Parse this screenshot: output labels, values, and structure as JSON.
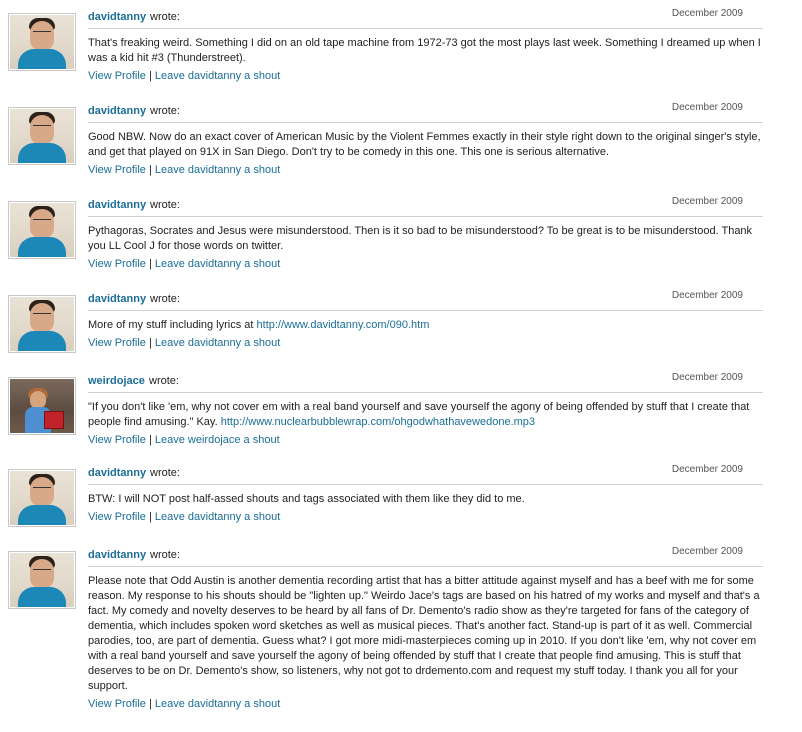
{
  "shouts": [
    {
      "author": "davidtanny",
      "wrote": "wrote:",
      "date": "December 2009",
      "avatar": "davidtanny-photo",
      "message": "That's freaking weird. Something I did on an old tape machine from 1972-73 got the most plays last week. Something I dreamed up when I was a kid hit #3 (Thunderstreet).",
      "link": "",
      "view_profile": "View Profile",
      "separator": "|",
      "leave_shout": "Leave davidtanny a shout"
    },
    {
      "author": "davidtanny",
      "wrote": "wrote:",
      "date": "December 2009",
      "avatar": "davidtanny-photo",
      "message": "Good NBW. Now do an exact cover of American Music by the Violent Femmes exactly in their style right down to the original singer's style, and get that played on 91X in San Diego. Don't try to be comedy in this one. This one is serious alternative.",
      "link": "",
      "view_profile": "View Profile",
      "separator": "|",
      "leave_shout": "Leave davidtanny a shout"
    },
    {
      "author": "davidtanny",
      "wrote": "wrote:",
      "date": "December 2009",
      "avatar": "davidtanny-photo",
      "message": "Pythagoras, Socrates and Jesus were misunderstood. Then is it so bad to be misunderstood? To be great is to be misunderstood. Thank you LL Cool J for those words on twitter.",
      "link": "",
      "view_profile": "View Profile",
      "separator": "|",
      "leave_shout": "Leave davidtanny a shout"
    },
    {
      "author": "davidtanny",
      "wrote": "wrote:",
      "date": "December 2009",
      "avatar": "davidtanny-photo",
      "message": "More of my stuff including lyrics at ",
      "link": "http://www.davidtanny.com/090.htm",
      "view_profile": "View Profile",
      "separator": "|",
      "leave_shout": "Leave davidtanny a shout"
    },
    {
      "author": "weirdojace",
      "wrote": "wrote:",
      "date": "December 2009",
      "avatar": "weirdojace-photo",
      "message": "\"If you don't like 'em, why not cover em with a real band yourself and save yourself the agony of being offended by stuff that I create that people find amusing.\" Kay. ",
      "link": "http://www.nuclearbubblewrap.com/ohgodwhathavewedone.mp3",
      "view_profile": "View Profile",
      "separator": "|",
      "leave_shout": "Leave weirdojace a shout"
    },
    {
      "author": "davidtanny",
      "wrote": "wrote:",
      "date": "December 2009",
      "avatar": "davidtanny-photo",
      "message": "BTW: I will NOT post half-assed shouts and tags associated with them like they did to me.",
      "link": "",
      "view_profile": "View Profile",
      "separator": "|",
      "leave_shout": "Leave davidtanny a shout"
    },
    {
      "author": "davidtanny",
      "wrote": "wrote:",
      "date": "December 2009",
      "avatar": "davidtanny-photo",
      "message": "Please note that Odd Austin is another dementia recording artist that has a bitter attitude against myself and has a beef with me for some reason. My response to his shouts should be \"lighten up.\" Weirdo Jace's tags are based on his hatred of my works and myself and that's a fact. My comedy and novelty deserves to be heard by all fans of Dr. Demento's radio show as they're targeted for fans of the category of dementia, which includes spoken word sketches as well as musical pieces. That's another fact. Stand-up is part of it as well. Commercial parodies, too, are part of dementia. Guess what? I got more midi-masterpieces coming up in 2010. If you don't like 'em, why not cover em with a real band yourself and save yourself the agony of being offended by stuff that I create that people find amusing. This is stuff that deserves to be on Dr. Demento's show, so listeners, why not got to drdemento.com and request my stuff today. I thank you all for your support.",
      "link": "",
      "view_profile": "View Profile",
      "separator": "|",
      "leave_shout": "Leave davidtanny a shout"
    }
  ]
}
